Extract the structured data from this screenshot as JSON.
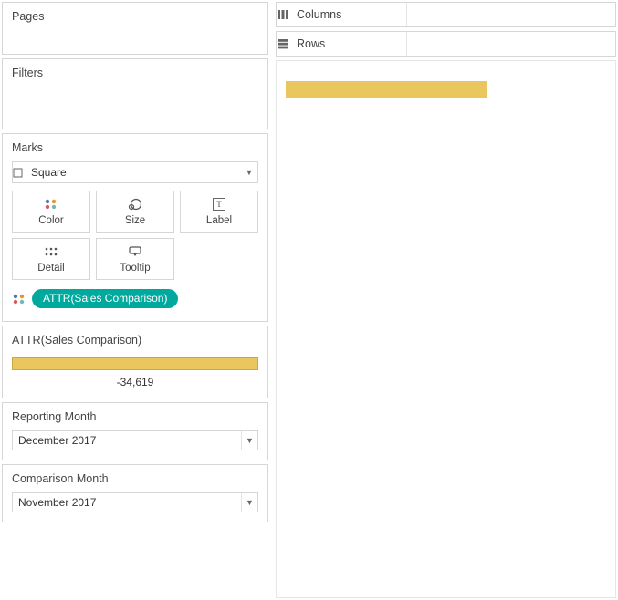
{
  "pages": {
    "title": "Pages"
  },
  "filters": {
    "title": "Filters"
  },
  "marks": {
    "title": "Marks",
    "markType": "Square",
    "props": {
      "color": "Color",
      "size": "Size",
      "label": "Label",
      "detail": "Detail",
      "tooltip": "Tooltip"
    },
    "colorPillLabel": "ATTR(Sales Comparison)"
  },
  "legend": {
    "title": "ATTR(Sales Comparison)",
    "value": "-34,619",
    "barColor": "#eac65f"
  },
  "params": {
    "reportingMonth": {
      "title": "Reporting Month",
      "value": "December 2017"
    },
    "comparisonMonth": {
      "title": "Comparison Month",
      "value": "November 2017"
    }
  },
  "shelves": {
    "columns": "Columns",
    "rows": "Rows"
  },
  "viz": {
    "markColor": "#eac65f"
  }
}
